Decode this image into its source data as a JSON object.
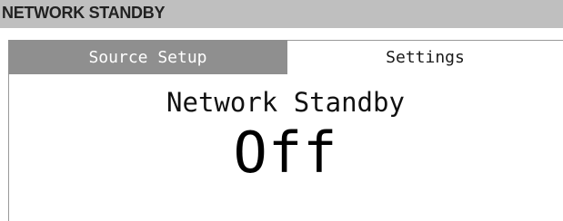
{
  "header": {
    "title": "NETWORK STANDBY"
  },
  "tabs": [
    {
      "label": "Source Setup",
      "selected": false
    },
    {
      "label": "Settings",
      "selected": true
    }
  ],
  "setting": {
    "name": "Network Standby",
    "value": "Off"
  },
  "colors": {
    "title_bar_bg": "#bfbfbf",
    "inactive_tab_bg": "#8f8f8f",
    "active_tab_bg": "#ffffff"
  }
}
